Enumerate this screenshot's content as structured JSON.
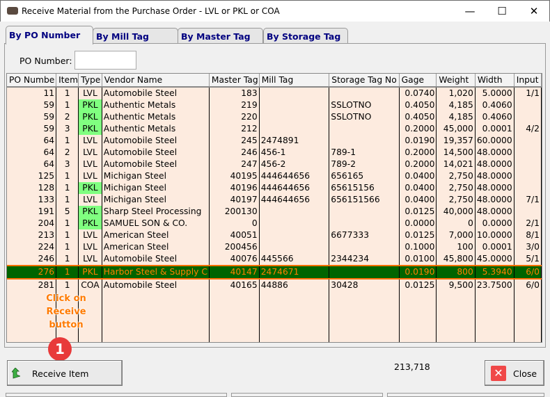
{
  "window": {
    "title": "Receive Material from the Purchase Order - LVL or PKL or COA",
    "minimize": "—",
    "maximize": "☐",
    "close": "✕"
  },
  "tabs": [
    {
      "label": "By PO Number",
      "active": true
    },
    {
      "label": "By Mill Tag"
    },
    {
      "label": "By Master Tag"
    },
    {
      "label": "By Storage Tag"
    }
  ],
  "filter": {
    "po_label": "PO Number:",
    "po_value": ""
  },
  "grid": {
    "columns": [
      "PO Numbe",
      "Item",
      "Type",
      "Vendor Name",
      "Master Tag",
      "Mill Tag",
      "Storage Tag No",
      "Gage",
      "Weight",
      "Width",
      "Input"
    ],
    "rows": [
      [
        "11",
        "1",
        "LVL",
        "Automobile Steel",
        "183",
        "",
        "",
        "0.0740",
        "1,020",
        "5.0000",
        "1/1"
      ],
      [
        "59",
        "1",
        "PKL",
        "Authentic Metals",
        "219",
        "",
        "SSLOTNO",
        "0.4050",
        "4,185",
        "0.4060",
        ""
      ],
      [
        "59",
        "2",
        "PKL",
        "Authentic Metals",
        "220",
        "",
        "SSLOTNO",
        "0.4050",
        "4,185",
        "0.4060",
        ""
      ],
      [
        "59",
        "3",
        "PKL",
        "Authentic Metals",
        "212",
        "",
        "",
        "0.2000",
        "45,000",
        "0.0001",
        "4/2"
      ],
      [
        "64",
        "1",
        "LVL",
        "Automobile Steel",
        "245",
        "2474891",
        "",
        "0.0190",
        "19,357",
        "60.0000",
        ""
      ],
      [
        "64",
        "2",
        "LVL",
        "Automobile Steel",
        "246",
        "456-1",
        "789-1",
        "0.2000",
        "14,500",
        "48.0000",
        ""
      ],
      [
        "64",
        "3",
        "LVL",
        "Automobile Steel",
        "247",
        "456-2",
        "789-2",
        "0.2000",
        "14,021",
        "48.0000",
        ""
      ],
      [
        "125",
        "1",
        "LVL",
        "Michigan Steel",
        "40195",
        "444644656",
        "656165",
        "0.0400",
        "2,750",
        "48.0000",
        ""
      ],
      [
        "128",
        "1",
        "PKL",
        "Michigan Steel",
        "40196",
        "444644656",
        "65615156",
        "0.0400",
        "2,750",
        "48.0000",
        ""
      ],
      [
        "133",
        "1",
        "LVL",
        "Michigan Steel",
        "40197",
        "444644656",
        "656151566",
        "0.0400",
        "2,750",
        "48.0000",
        "7/1"
      ],
      [
        "191",
        "5",
        "PKL",
        "Sharp Steel Processing",
        "200130",
        "",
        "",
        "0.0125",
        "40,000",
        "48.0000",
        ""
      ],
      [
        "204",
        "1",
        "PKL",
        "SAMUEL SON & CO.",
        "0",
        "",
        "",
        "0.0000",
        "0",
        "0.0000",
        "2/1"
      ],
      [
        "213",
        "1",
        "LVL",
        "American Steel",
        "40051",
        "",
        "6677333",
        "0.0125",
        "7,000",
        "10.0000",
        "8/1"
      ],
      [
        "224",
        "1",
        "LVL",
        "American Steel",
        "200456",
        "",
        "",
        "0.1000",
        "100",
        "0.0001",
        "3/0"
      ],
      [
        "246",
        "1",
        "LVL",
        "Automobile Steel",
        "40076",
        "445566",
        "2344234",
        "0.0100",
        "45,800",
        "45.0000",
        "5/1"
      ],
      [
        "276",
        "1",
        "PKL",
        "Harbor Steel & Supply C",
        "40147",
        "2474671",
        "",
        "0.0190",
        "800",
        "5.3940",
        "6/0"
      ],
      [
        "281",
        "1",
        "COA",
        "Automobile Steel",
        "40165",
        "44886",
        "30428",
        "0.0125",
        "9,500",
        "23.7500",
        "6/0"
      ]
    ],
    "selected_row": 15
  },
  "annotation": {
    "text1": "Click on",
    "text2": "Receive",
    "text3": "button",
    "step": "1"
  },
  "footer": {
    "receive_label": "Receive Item",
    "total": "213,718",
    "close_label": "Close"
  },
  "colors": {
    "row_bg": "#fdebdf",
    "pkl_bg": "#80ff80",
    "selected_bg": "#006400",
    "selected_text": "#ff8000",
    "annotation": "#ff7a00",
    "badge": "#e83a3a"
  }
}
